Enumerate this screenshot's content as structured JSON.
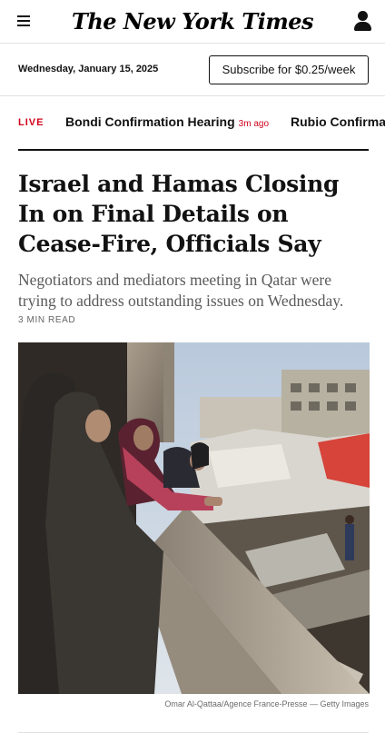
{
  "header": {
    "logo_text": "The New York Times",
    "menu_icon": "hamburger-icon",
    "account_icon": "user-icon"
  },
  "datebar": {
    "date": "Wednesday, January 15, 2025",
    "subscribe_label": "Subscribe for $0.25/week"
  },
  "ticker": {
    "live_label": "LIVE",
    "items": [
      {
        "title": "Bondi Confirmation Hearing",
        "ago": "3m ago"
      },
      {
        "title": "Rubio Confirmation",
        "ago": ""
      }
    ]
  },
  "article": {
    "headline": "Israel and Hamas Closing In on Final Details on Cease-Fire, Officials Say",
    "summary": "Negotiators and mediators meeting in Qatar were trying to address outstanding issues on Wednesday.",
    "read_time": "3 MIN READ",
    "photo_credit": "Omar Al-Qattaa/Agence France-Presse — Getty Images"
  },
  "colors": {
    "accent_live": "#d0021b",
    "text": "#121212"
  }
}
